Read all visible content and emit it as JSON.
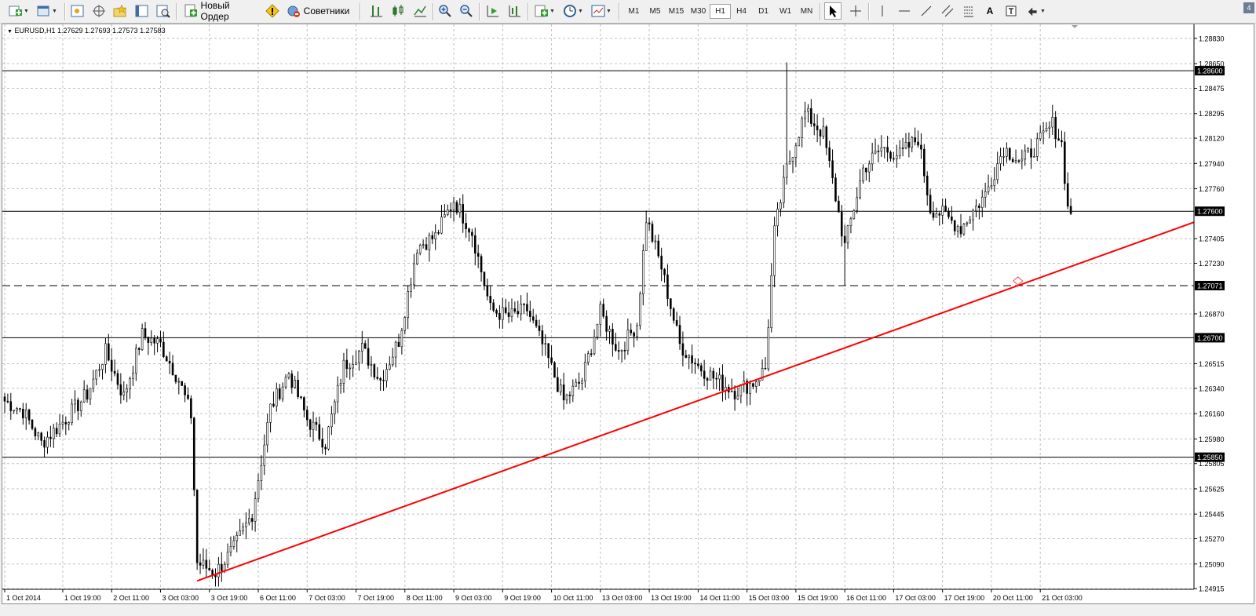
{
  "toolbar": {
    "new_order_label": "Новый Ордер",
    "advisors_label": "Советники",
    "timeframes": [
      {
        "label": "M1",
        "active": false
      },
      {
        "label": "M5",
        "active": false
      },
      {
        "label": "M15",
        "active": false
      },
      {
        "label": "M30",
        "active": false
      },
      {
        "label": "H1",
        "active": true
      },
      {
        "label": "H4",
        "active": false
      },
      {
        "label": "D1",
        "active": false
      },
      {
        "label": "W1",
        "active": false
      },
      {
        "label": "MN",
        "active": false
      }
    ],
    "text_tool_label": "A",
    "window_badge": "4"
  },
  "chart": {
    "title": "EURUSD,H1  1.27629 1.27693 1.27573 1.27583",
    "colors": {
      "trendline": "#ff0000",
      "hline": "#000000",
      "grid": "#c0c0c0",
      "candle": "#000000"
    }
  },
  "chart_data": {
    "type": "candlestick",
    "symbol": "EURUSD",
    "timeframe": "H1",
    "ohlc_last": {
      "open": 1.27629,
      "high": 1.27693,
      "low": 1.27573,
      "close": 1.27583
    },
    "ylim": [
      1.2491,
      1.2893
    ],
    "y_ticks": [
      "1.28830",
      "1.28650",
      "1.28475",
      "1.28295",
      "1.28120",
      "1.27940",
      "1.27760",
      "1.27405",
      "1.27230",
      "1.26870",
      "1.26515",
      "1.26340",
      "1.26160",
      "1.25980",
      "1.25805",
      "1.25625",
      "1.25445",
      "1.25270",
      "1.25090",
      "1.24915"
    ],
    "x_ticks": [
      "1 Oct 2014",
      "1 Oct 19:00",
      "2 Oct 11:00",
      "3 Oct 03:00",
      "3 Oct 19:00",
      "6 Oct 11:00",
      "7 Oct 03:00",
      "7 Oct 19:00",
      "8 Oct 11:00",
      "9 Oct 03:00",
      "9 Oct 19:00",
      "10 Oct 11:00",
      "13 Oct 03:00",
      "13 Oct 19:00",
      "14 Oct 11:00",
      "15 Oct 03:00",
      "15 Oct 19:00",
      "16 Oct 11:00",
      "17 Oct 03:00",
      "17 Oct 19:00",
      "20 Oct 11:00",
      "21 Oct 03:00"
    ],
    "horizontal_lines": [
      {
        "price": 1.286,
        "label": "1.28600",
        "style": "solid"
      },
      {
        "price": 1.276,
        "label": "1.27600",
        "style": "solid"
      },
      {
        "price": 1.27071,
        "label": "1.27071",
        "style": "dashed"
      },
      {
        "price": 1.267,
        "label": "1.26700",
        "style": "solid"
      },
      {
        "price": 1.2585,
        "label": "1.25850",
        "style": "solid"
      }
    ],
    "trendline": {
      "from": {
        "x": "3 Oct 15:00",
        "y": 1.2497
      },
      "to": {
        "x": "21 Oct 16:00",
        "y": 1.2723
      },
      "color": "#ff0000"
    },
    "price_path": [
      {
        "x": "1 Oct 00:00",
        "close": 1.2625
      },
      {
        "x": "1 Oct 06:00",
        "close": 1.2618
      },
      {
        "x": "1 Oct 12:00",
        "close": 1.2595
      },
      {
        "x": "1 Oct 19:00",
        "close": 1.261
      },
      {
        "x": "2 Oct 03:00",
        "close": 1.263
      },
      {
        "x": "2 Oct 09:00",
        "close": 1.266
      },
      {
        "x": "2 Oct 15:00",
        "close": 1.2628
      },
      {
        "x": "2 Oct 21:00",
        "close": 1.2672
      },
      {
        "x": "3 Oct 03:00",
        "close": 1.2665
      },
      {
        "x": "3 Oct 09:00",
        "close": 1.264
      },
      {
        "x": "3 Oct 13:00",
        "close": 1.2615
      },
      {
        "x": "3 Oct 15:00",
        "close": 1.251
      },
      {
        "x": "3 Oct 21:00",
        "close": 1.2503
      },
      {
        "x": "6 Oct 03:00",
        "close": 1.252
      },
      {
        "x": "6 Oct 09:00",
        "close": 1.2545
      },
      {
        "x": "6 Oct 15:00",
        "close": 1.262
      },
      {
        "x": "6 Oct 21:00",
        "close": 1.2645
      },
      {
        "x": "7 Oct 03:00",
        "close": 1.2612
      },
      {
        "x": "7 Oct 09:00",
        "close": 1.2595
      },
      {
        "x": "7 Oct 15:00",
        "close": 1.265
      },
      {
        "x": "7 Oct 21:00",
        "close": 1.2662
      },
      {
        "x": "8 Oct 03:00",
        "close": 1.264
      },
      {
        "x": "8 Oct 09:00",
        "close": 1.2668
      },
      {
        "x": "8 Oct 15:00",
        "close": 1.2735
      },
      {
        "x": "8 Oct 21:00",
        "close": 1.2742
      },
      {
        "x": "9 Oct 03:00",
        "close": 1.2768
      },
      {
        "x": "9 Oct 09:00",
        "close": 1.2745
      },
      {
        "x": "9 Oct 15:00",
        "close": 1.269
      },
      {
        "x": "9 Oct 21:00",
        "close": 1.2685
      },
      {
        "x": "10 Oct 03:00",
        "close": 1.269
      },
      {
        "x": "10 Oct 09:00",
        "close": 1.266
      },
      {
        "x": "10 Oct 15:00",
        "close": 1.2625
      },
      {
        "x": "10 Oct 21:00",
        "close": 1.264
      },
      {
        "x": "13 Oct 03:00",
        "close": 1.2688
      },
      {
        "x": "13 Oct 09:00",
        "close": 1.266
      },
      {
        "x": "13 Oct 15:00",
        "close": 1.268
      },
      {
        "x": "13 Oct 18:00",
        "close": 1.2755
      },
      {
        "x": "13 Oct 23:00",
        "close": 1.272
      },
      {
        "x": "14 Oct 05:00",
        "close": 1.2665
      },
      {
        "x": "14 Oct 11:00",
        "close": 1.265
      },
      {
        "x": "14 Oct 17:00",
        "close": 1.264
      },
      {
        "x": "14 Oct 23:00",
        "close": 1.2632
      },
      {
        "x": "15 Oct 05:00",
        "close": 1.2638
      },
      {
        "x": "15 Oct 09:00",
        "close": 1.2648
      },
      {
        "x": "15 Oct 12:00",
        "close": 1.2745
      },
      {
        "x": "15 Oct 16:00",
        "close": 1.279
      },
      {
        "x": "15 Oct 22:00",
        "close": 1.283
      },
      {
        "x": "16 Oct 04:00",
        "close": 1.2815
      },
      {
        "x": "16 Oct 08:00",
        "close": 1.277
      },
      {
        "x": "16 Oct 11:00",
        "close": 1.2735
      },
      {
        "x": "16 Oct 17:00",
        "close": 1.279
      },
      {
        "x": "16 Oct 23:00",
        "close": 1.2805
      },
      {
        "x": "17 Oct 05:00",
        "close": 1.28
      },
      {
        "x": "17 Oct 11:00",
        "close": 1.2812
      },
      {
        "x": "17 Oct 15:00",
        "close": 1.2762
      },
      {
        "x": "17 Oct 19:00",
        "close": 1.2758
      },
      {
        "x": "20 Oct 01:00",
        "close": 1.2748
      },
      {
        "x": "20 Oct 05:00",
        "close": 1.276
      },
      {
        "x": "20 Oct 09:00",
        "close": 1.2772
      },
      {
        "x": "20 Oct 15:00",
        "close": 1.2805
      },
      {
        "x": "20 Oct 21:00",
        "close": 1.2795
      },
      {
        "x": "21 Oct 03:00",
        "close": 1.281
      },
      {
        "x": "21 Oct 07:00",
        "close": 1.2822
      },
      {
        "x": "21 Oct 10:00",
        "close": 1.2808
      },
      {
        "x": "21 Oct 12:00",
        "close": 1.2762
      },
      {
        "x": "21 Oct 13:00",
        "close": 1.27583
      }
    ],
    "spikes": [
      {
        "x": "15 Oct 16:00",
        "high": 1.2866
      },
      {
        "x": "16 Oct 11:00",
        "low": 1.2707
      }
    ],
    "grid": true
  }
}
